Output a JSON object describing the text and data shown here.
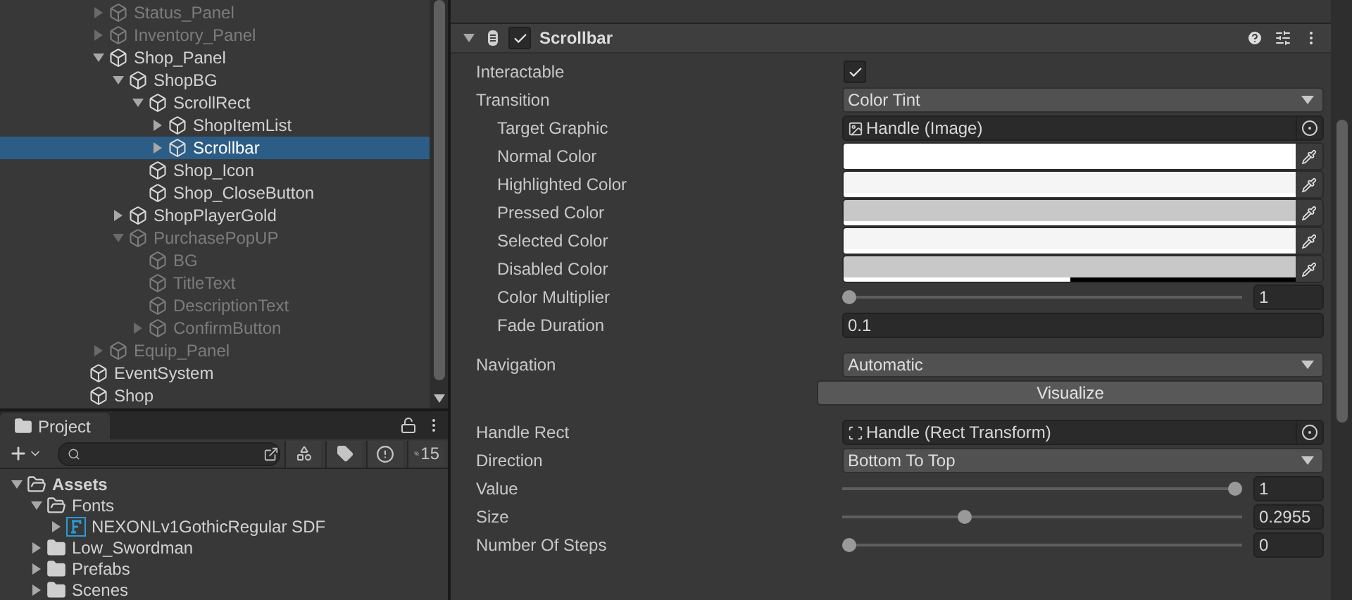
{
  "hierarchy": {
    "cut_off_children": [
      {
        "name": "Status_Panel",
        "expandable": true,
        "expanded": false,
        "dimmed": true,
        "selected": false
      },
      {
        "name": "Inventory_Panel",
        "expandable": true,
        "expanded": false,
        "dimmed": true,
        "selected": false
      },
      {
        "name": "Shop_Panel",
        "expandable": true,
        "expanded": true,
        "dimmed": false,
        "selected": false,
        "children": [
          {
            "name": "ShopBG",
            "expandable": true,
            "expanded": true,
            "dimmed": false,
            "selected": false,
            "children": [
              {
                "name": "ScrollRect",
                "expandable": true,
                "expanded": true,
                "dimmed": false,
                "selected": false,
                "children": [
                  {
                    "name": "ShopItemList",
                    "expandable": true,
                    "expanded": false,
                    "dimmed": false,
                    "selected": false
                  },
                  {
                    "name": "Scrollbar",
                    "expandable": true,
                    "expanded": false,
                    "dimmed": false,
                    "selected": true
                  }
                ]
              },
              {
                "name": "Shop_Icon",
                "expandable": false,
                "dimmed": false,
                "selected": false
              },
              {
                "name": "Shop_CloseButton",
                "expandable": false,
                "dimmed": false,
                "selected": false
              }
            ]
          },
          {
            "name": "ShopPlayerGold",
            "expandable": true,
            "expanded": false,
            "dimmed": false,
            "selected": false
          },
          {
            "name": "PurchasePopUP",
            "expandable": true,
            "expanded": true,
            "dimmed": true,
            "selected": false,
            "children": [
              {
                "name": "BG",
                "expandable": false,
                "dimmed": true,
                "selected": false
              },
              {
                "name": "TitleText",
                "expandable": false,
                "dimmed": true,
                "selected": false
              },
              {
                "name": "DescriptionText",
                "expandable": false,
                "dimmed": true,
                "selected": false
              },
              {
                "name": "ConfirmButton",
                "expandable": true,
                "expanded": false,
                "dimmed": true,
                "selected": false
              }
            ]
          }
        ]
      },
      {
        "name": "Equip_Panel",
        "expandable": true,
        "expanded": false,
        "dimmed": true,
        "selected": false
      }
    ],
    "items": [
      {
        "name": "EventSystem",
        "expandable": false,
        "dimmed": false,
        "selected": false
      },
      {
        "name": "Shop",
        "expandable": false,
        "dimmed": false,
        "selected": false
      }
    ]
  },
  "project": {
    "tab": "Project",
    "hidden_count": "15",
    "tree": [
      {
        "name": "Assets",
        "kind": "folder",
        "expanded": true,
        "children": [
          {
            "name": "Fonts",
            "kind": "folder",
            "expanded": true,
            "children": [
              {
                "name": "NEXONLv1GothicRegular SDF",
                "kind": "font",
                "expanded": false
              }
            ]
          },
          {
            "name": "Low_Swordman",
            "kind": "folder",
            "expanded": false
          },
          {
            "name": "Prefabs",
            "kind": "folder",
            "expanded": false
          },
          {
            "name": "Scenes",
            "kind": "folder",
            "expanded": false
          }
        ]
      }
    ]
  },
  "inspector": {
    "component": {
      "title": "Scrollbar",
      "enabled": true,
      "expanded": true
    },
    "groups": [
      [
        {
          "kind": "checkbox",
          "label": "Interactable",
          "indented": false,
          "checked": true
        },
        {
          "kind": "dropdown",
          "label": "Transition",
          "indented": false,
          "value": "Color Tint"
        },
        {
          "kind": "imageref",
          "label": "Target Graphic",
          "indented": true,
          "value": "Handle (Image)"
        },
        {
          "kind": "color",
          "label": "Normal Color",
          "indented": true,
          "color": "#ffffff",
          "level": 1
        },
        {
          "kind": "color",
          "label": "Highlighted Color",
          "indented": true,
          "color": "#f5f5f5",
          "level": 1
        },
        {
          "kind": "color",
          "label": "Pressed Color",
          "indented": true,
          "color": "#c8c8c8",
          "level": 1
        },
        {
          "kind": "color",
          "label": "Selected Color",
          "indented": true,
          "color": "#f5f5f5",
          "level": 1
        },
        {
          "kind": "color",
          "label": "Disabled Color",
          "indented": true,
          "color": "#c8c8c8",
          "level": 0.5
        },
        {
          "kind": "slider",
          "label": "Color Multiplier",
          "indented": true,
          "level": 0,
          "value": "1"
        },
        {
          "kind": "float",
          "label": "Fade Duration",
          "indented": true,
          "value": "0.1"
        }
      ],
      [
        {
          "kind": "dropdown",
          "label": "Navigation",
          "indented": false,
          "value": "Automatic"
        },
        {
          "kind": "button",
          "value": "Visualize"
        }
      ],
      [
        {
          "kind": "rectref",
          "label": "Handle Rect",
          "indented": false,
          "value": "Handle (Rect Transform)"
        },
        {
          "kind": "dropdown",
          "label": "Direction",
          "indented": false,
          "value": "Bottom To Top"
        },
        {
          "kind": "slider",
          "label": "Value",
          "indented": false,
          "level": 1,
          "value": "1"
        },
        {
          "kind": "slider",
          "label": "Size",
          "indented": false,
          "level": 0.3,
          "value": "0.2955"
        },
        {
          "kind": "slider",
          "label": "Number Of Steps",
          "indented": false,
          "level": 0,
          "value": "0"
        }
      ]
    ]
  }
}
